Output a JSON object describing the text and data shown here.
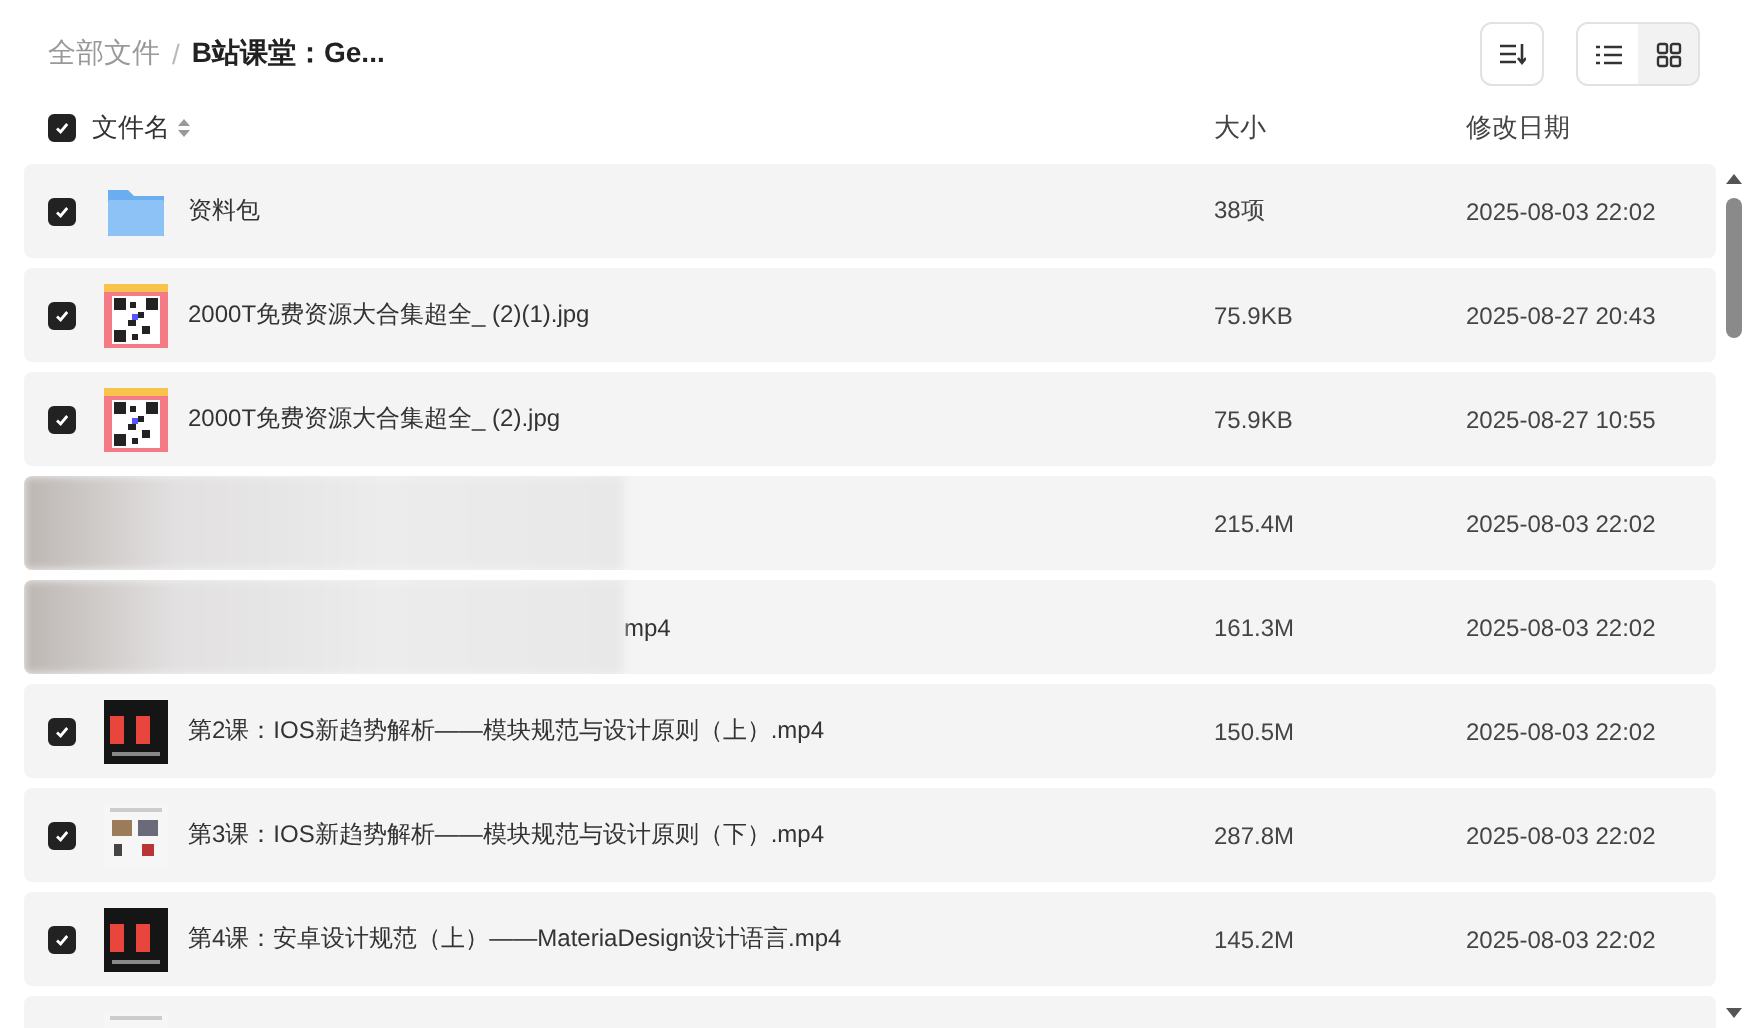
{
  "breadcrumb": [
    {
      "label": "全部文件",
      "current": false
    },
    {
      "label": "B站课堂：Ge...",
      "current": true
    }
  ],
  "breadcrumb_separator": "/",
  "view_modes": [
    {
      "kind": "list",
      "selected": true
    },
    {
      "kind": "grid",
      "selected": false
    }
  ],
  "header": {
    "checked": true,
    "name": "文件名",
    "size": "大小",
    "date": "修改日期"
  },
  "rows": [
    {
      "kind": "folder",
      "checked": true,
      "name": "资料包",
      "size": "38项",
      "date": "2025-08-03 22:02"
    },
    {
      "kind": "qr",
      "checked": true,
      "name": "2000T免费资源大合集超全_ (2)(1).jpg",
      "size": "75.9KB",
      "date": "2025-08-27 20:43"
    },
    {
      "kind": "qr",
      "checked": true,
      "name": "2000T免费资源大合集超全_ (2).jpg",
      "size": "75.9KB",
      "date": "2025-08-27 10:55"
    },
    {
      "kind": "obscured",
      "size": "215.4M",
      "date": "2025-08-03 22:02"
    },
    {
      "kind": "obscured",
      "name": "mp4",
      "size": "161.3M",
      "date": "2025-08-03 22:02"
    },
    {
      "kind": "video-dark",
      "checked": true,
      "name": "第2课：IOS新趋势解析——模块规范与设计原则（上）.mp4",
      "size": "150.5M",
      "date": "2025-08-03 22:02"
    },
    {
      "kind": "video-light",
      "checked": true,
      "name": "第3课：IOS新趋势解析——模块规范与设计原则（下）.mp4",
      "size": "287.8M",
      "date": "2025-08-03 22:02"
    },
    {
      "kind": "video-dark",
      "checked": true,
      "name": "第4课：安卓设计规范（上）——MateriaDesign设计语言.mp4",
      "size": "145.2M",
      "date": "2025-08-03 22:02"
    },
    {
      "kind": "video-light"
    }
  ]
}
